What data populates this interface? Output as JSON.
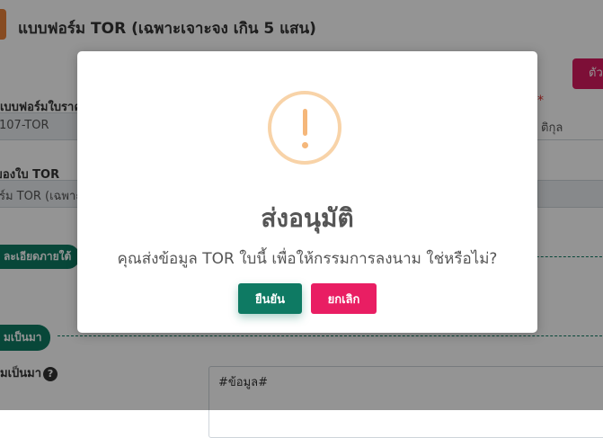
{
  "page": {
    "title": "แบบฟอร์ม TOR (เฉพาะเจาะจง เกิน 5 แสน)",
    "top_right_button": "ตัว",
    "required_marker": "*",
    "fields": [
      {
        "label": "แบบฟอร์มใบราคา",
        "value": "107-TOR"
      },
      {
        "label": "ของใบ TOR",
        "value": "ร์ม TOR (เฉพาะ"
      }
    ],
    "right_field_value": "ติกุล",
    "sections": [
      {
        "label": "ละเอียดภายใต้"
      },
      {
        "label": "มเป็นมา"
      }
    ],
    "background_label": "มเป็นมา",
    "help_glyph": "?",
    "textarea_value": "#ข้อมูล#"
  },
  "modal": {
    "icon_glyph": "!",
    "title": "ส่งอนุมัติ",
    "message": "คุณส่งข้อมูล TOR ใบนี้ เพื่อให้กรรมการลงนาม ใช่หรือไม่?",
    "confirm_label": "ยืนยัน",
    "cancel_label": "ยกเลิก"
  },
  "colors": {
    "accent_green": "#0e7a63",
    "accent_pink": "#e91e63",
    "warning_orange": "#f5b77a"
  }
}
